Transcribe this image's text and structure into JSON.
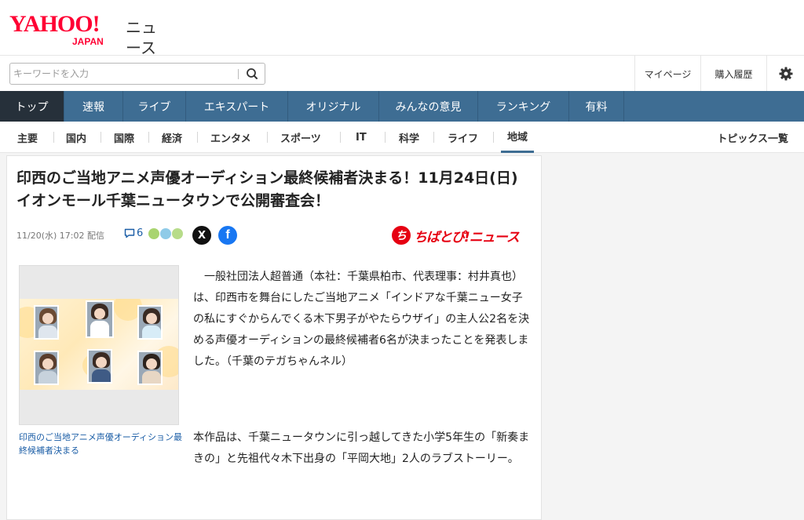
{
  "header": {
    "logo_text": "YAHOO!",
    "logo_sub": "JAPAN",
    "service_name": "ニュース"
  },
  "search": {
    "placeholder": "キーワードを入力"
  },
  "user_nav": {
    "mypage": "マイページ",
    "history": "購入履歴",
    "settings_icon": "gear-icon"
  },
  "main_nav": {
    "tabs": [
      {
        "label": "トップ",
        "active": true
      },
      {
        "label": "速報"
      },
      {
        "label": "ライブ"
      },
      {
        "label": "エキスパート"
      },
      {
        "label": "オリジナル"
      },
      {
        "label": "みんなの意見"
      },
      {
        "label": "ランキング"
      },
      {
        "label": "有料"
      }
    ]
  },
  "sub_nav": {
    "categories": [
      "主要",
      "国内",
      "国際",
      "経済",
      "エンタメ",
      "スポーツ",
      "IT",
      "科学",
      "ライフ",
      "地域"
    ],
    "active": "地域",
    "topics_link": "トピックス一覧"
  },
  "article": {
    "headline": "印西のご当地アニメ声優オーディション最終候補者決まる！11月24日(日)イオンモール千葉ニュータウンで公開審査会！",
    "date": "11/20(水) 17:02 配信",
    "comment_count": "6",
    "share_x": "X",
    "share_facebook": "f",
    "source_mark": "ち",
    "source_name": "ちばとぴ!ニュース",
    "image_caption": "印西のご当地アニメ声優オーディション最終候補者決まる",
    "paragraphs": [
      "　一般社団法人超普通（本社：千葉県柏市、代表理事：村井真也）は、印西市を舞台にしたご当地アニメ「インドアな千葉ニュー女子の私にすぐからんでくる木下男子がやたらウザイ」の主人公2名を決める声優オーディションの最終候補者6名が決まったことを発表しました。（千葉のテガちゃんネル）",
      "本作品は、千葉ニュータウンに引っ越してきた小学5年生の「新奏まきの」と先祖代々木下出身の「平岡大地」2人のラブストーリー。"
    ]
  },
  "colors": {
    "brand_red": "#ff0033",
    "nav_blue": "#3e6d93",
    "nav_active": "#26303a",
    "link_blue": "#1a5da6",
    "source_red": "#e60012"
  }
}
